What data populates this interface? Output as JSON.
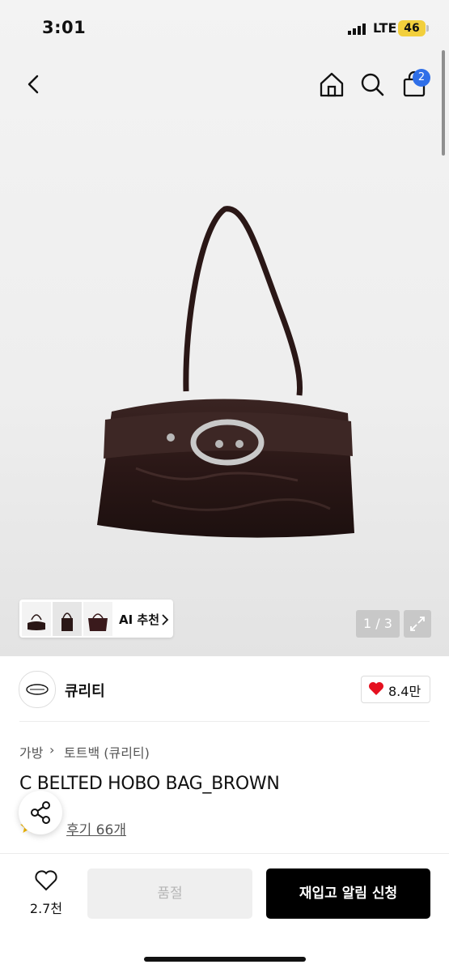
{
  "status_bar": {
    "time": "3:01",
    "network": "LTE",
    "battery": "46"
  },
  "nav": {
    "cart_count": "2",
    "icons": [
      "back-icon",
      "home-icon",
      "search-icon",
      "cart-icon"
    ]
  },
  "gallery": {
    "ai_label": "AI 추천",
    "pager": "1 / 3",
    "thumb_count": 3
  },
  "brand": {
    "name": "큐리티",
    "likes": "8.4만"
  },
  "category": {
    "primary": "가방",
    "secondary": "토트백 (큐리티)"
  },
  "product": {
    "title": "C BELTED HOBO BAG_BROWN",
    "review_label": "후기 66개"
  },
  "bottom_bar": {
    "wish_count": "2.7천",
    "soldout_label": "품절",
    "restock_label": "재입고 알림 신청"
  },
  "colors": {
    "accent": "#2f6fe8",
    "heart": "#e5101f",
    "primary_button": "#000000",
    "battery": "#f2cf3c"
  }
}
